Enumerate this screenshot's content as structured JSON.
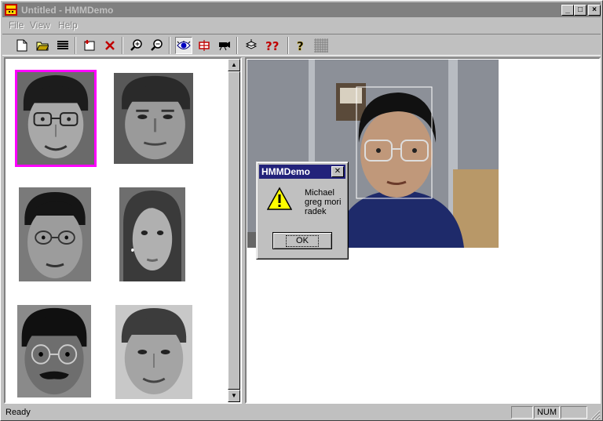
{
  "window": {
    "title": "Untitled - HMMDemo"
  },
  "titlebar": {
    "minimize": "_",
    "maximize": "□",
    "close": "×"
  },
  "menu": {
    "items": [
      "File",
      "View",
      "Help"
    ]
  },
  "toolbar": {
    "icons": [
      "new-file-icon",
      "open-folder-icon",
      "list-icon",
      "add-face-icon",
      "delete-icon",
      "zoom-in-icon",
      "zoom-out-icon",
      "eye-icon",
      "train-icon",
      "camera-icon",
      "stack-icon",
      "recognize-icon",
      "help-icon",
      "grid-icon"
    ]
  },
  "dialog": {
    "title": "HMMDemo",
    "lines": [
      "Michael",
      "greg mori",
      "radek"
    ],
    "ok_label": "OK"
  },
  "status": {
    "text": "Ready",
    "num": "NUM"
  }
}
